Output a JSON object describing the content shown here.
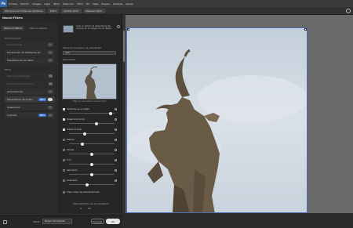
{
  "app": {
    "logo": "Ps"
  },
  "menubar": [
    "Archivo",
    "Edición",
    "Imagen",
    "Capa",
    "Texto",
    "Selección",
    "Filtro",
    "3D",
    "Vista",
    "Plugins",
    "Ventana",
    "Ayuda"
  ],
  "options": {
    "field1": "Ubicación en todas las ventanas",
    "field2": "100%",
    "field3": "Ajustar pant.",
    "field4": "Rellenar pant."
  },
  "panel": {
    "title": "Neural Filters",
    "tabs": [
      "Todos los filtros",
      "Lista de espera"
    ],
    "sections": [
      {
        "heading": "DESTACADOS",
        "items": [
          {
            "label": "Suavizar piel",
            "enabled": false,
            "dim": true
          },
          {
            "label": "Eliminación de artefactos JP...",
            "enabled": false,
            "dim": false
          },
          {
            "label": "Transferencia de estilo",
            "enabled": false,
            "dim": false
          }
        ]
      },
      {
        "heading": "BETA",
        "items": [
          {
            "label": "Retoque inteligente",
            "enabled": false,
            "dim": true
          },
          {
            "label": "Transferencia de estilo",
            "enabled": false,
            "dim": true
          },
          {
            "label": "Armonización",
            "enabled": false,
            "dim": false
          },
          {
            "label": "Desenfoque de profu...",
            "enabled": true,
            "dim": false,
            "badge": "BETA"
          },
          {
            "label": "Superzoom",
            "enabled": false,
            "dim": false
          },
          {
            "label": "Colorear",
            "enabled": false,
            "dim": false,
            "badge": "BETA"
          }
        ]
      }
    ],
    "description": "Crea un efecto de desenfoque del entorno en la imagen de un objeto.",
    "focus_label": "Ubicación del espacio de profundidad",
    "focus_value": "Auto",
    "preview_label": "Previsualizar",
    "preview_caption": "Haga clic para definir el punto focal",
    "props": [
      {
        "label": "Centrarse en el objeto",
        "checked": true,
        "slider": 0.92
      },
      {
        "label": "Desenfocar fondo",
        "checked": true,
        "slider": 0.6
      },
      {
        "label": "Distancia focal",
        "checked": true,
        "slider": 0.35
      },
      {
        "label": "Neblina",
        "checked": false,
        "slider": 0.3
      },
      {
        "label": "Calidez",
        "checked": false,
        "slider": 0.5
      },
      {
        "label": "Tono",
        "checked": false,
        "slider": 0.5
      },
      {
        "label": "Saturación",
        "checked": false,
        "slider": 0.5
      },
      {
        "label": "Granulado",
        "checked": false,
        "slider": 0.4
      },
      {
        "label": "Crear mapa de profundidad solo",
        "checked": false,
        "slider": null
      }
    ],
    "question": "¿Está satisfecho con los resultados?",
    "answers": [
      "Sí",
      "No"
    ],
    "output_label": "Salida",
    "output_value": "Nuevo documento",
    "cancel": "Cancelar",
    "ok": "OK"
  }
}
